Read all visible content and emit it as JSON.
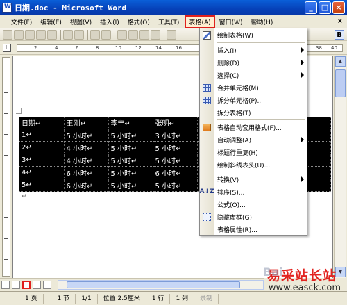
{
  "window": {
    "title": "日期.doc - Microsoft Word",
    "buttons": {
      "minimize": "_",
      "maximize": "□",
      "close": "×"
    }
  },
  "menubar": {
    "items": [
      {
        "label": "文件(F)"
      },
      {
        "label": "编辑(E)"
      },
      {
        "label": "视图(V)"
      },
      {
        "label": "插入(I)"
      },
      {
        "label": "格式(O)"
      },
      {
        "label": "工具(T)"
      },
      {
        "label": "表格(A)",
        "active": true
      },
      {
        "label": "窗口(W)"
      },
      {
        "label": "帮助(H)"
      }
    ],
    "close_glyph": "×"
  },
  "toolbar": {
    "bold_label": "B"
  },
  "ruler": {
    "tab_selector": "L",
    "numbers": [
      "2",
      "4",
      "6",
      "8",
      "10",
      "12",
      "14",
      "16",
      "38",
      "40"
    ]
  },
  "table_menu": {
    "items": [
      {
        "label": "绘制表格(W)",
        "icon": "pencil-icon",
        "separator_after": true
      },
      {
        "label": "插入(I)",
        "submenu": true
      },
      {
        "label": "删除(D)",
        "submenu": true
      },
      {
        "label": "选择(C)",
        "submenu": true
      },
      {
        "label": "合并单元格(M)",
        "icon": "merge-cells-icon"
      },
      {
        "label": "拆分单元格(P)...",
        "icon": "split-cells-icon"
      },
      {
        "label": "拆分表格(T)",
        "separator_after": true
      },
      {
        "label": "表格自动套用格式(F)...",
        "icon": "autoformat-icon"
      },
      {
        "label": "自动调整(A)",
        "submenu": true
      },
      {
        "label": "标题行重复(H)"
      },
      {
        "label": "绘制斜线表头(U)...",
        "separator_after": true
      },
      {
        "label": "转换(V)",
        "submenu": true
      },
      {
        "label": "排序(S)...",
        "icon": "sort-icon"
      },
      {
        "label": "公式(O)..."
      },
      {
        "label": "隐藏虚框(G)",
        "icon": "hide-gridlines-icon",
        "separator_after": true
      },
      {
        "label": "表格属性(R)..."
      }
    ]
  },
  "document_table": {
    "rows": [
      [
        "日期↵",
        "王刚↵",
        "李宁↵",
        "张明↵",
        "",
        "",
        ""
      ],
      [
        "1↵",
        "5 小时↵",
        "5 小时↵",
        "3 小时↵",
        "",
        "",
        ""
      ],
      [
        "2↵",
        "4 小时↵",
        "5 小时↵",
        "5 小时↵",
        "",
        "",
        ""
      ],
      [
        "3↵",
        "4 小时↵",
        "5 小时↵",
        "5 小时↵",
        "",
        "",
        ""
      ],
      [
        "4↵",
        "6 小时↵",
        "5 小时↵",
        "6 小时↵",
        "",
        "",
        ""
      ],
      [
        "5↵",
        "6 小时↵",
        "5 小时↵",
        "5 小时↵",
        "",
        "",
        ""
      ]
    ],
    "after_mark": "↵"
  },
  "statusbar": {
    "page": "1 页",
    "section": "1 节",
    "page_of": "1/1",
    "position": "位置 2.5厘米",
    "line": "1 行",
    "column": "1 列",
    "rec": "录制"
  },
  "watermark": {
    "cn": "易采站长站",
    "en": "www.easck.com",
    "faint": "Bai"
  }
}
